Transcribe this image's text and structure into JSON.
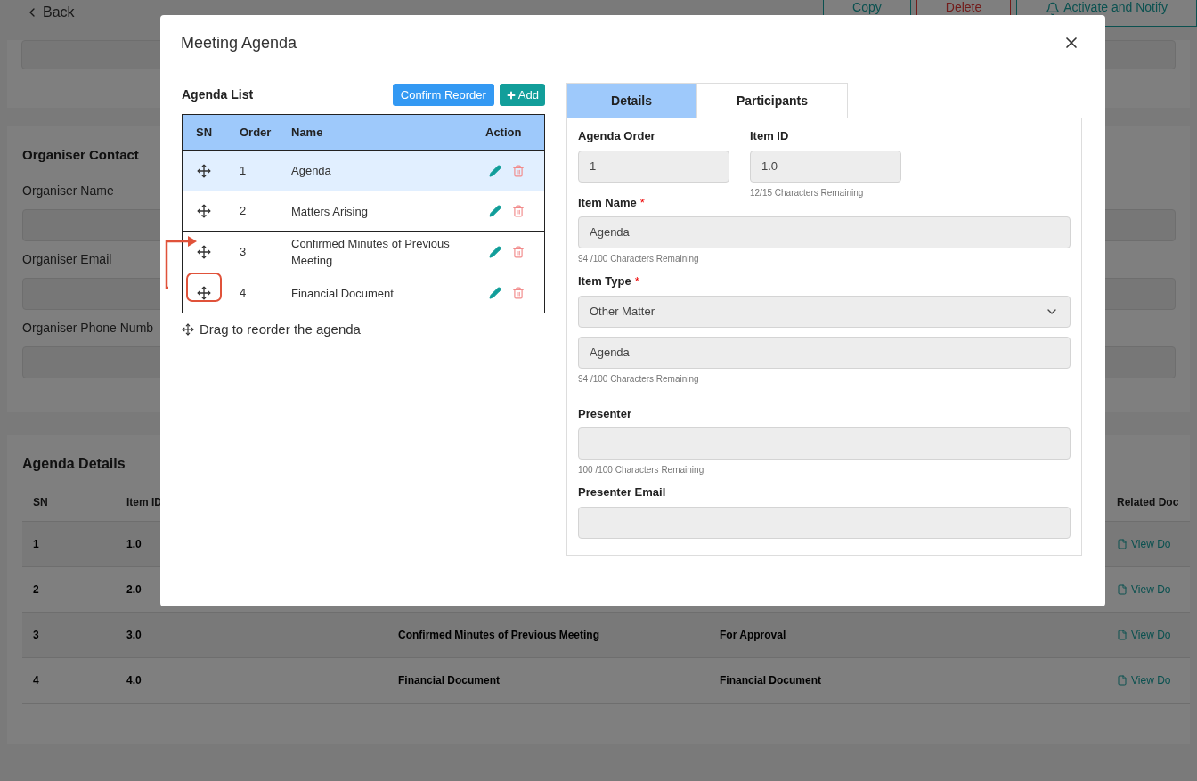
{
  "page": {
    "back": "Back",
    "header_buttons": [
      {
        "label": "Copy",
        "kind": "outline"
      },
      {
        "label": "Delete",
        "kind": "danger"
      },
      {
        "label": "Activate and Notify",
        "kind": "primary"
      }
    ],
    "organiser": {
      "title": "Organiser Contact",
      "fields": [
        "Organiser Name",
        "Organiser Email",
        "Organiser Phone Numb"
      ]
    },
    "agenda_details": {
      "title": "Agenda Details",
      "columns": {
        "sn": "SN",
        "item_id": "Item ID",
        "related": "Related Doc"
      },
      "rows": [
        {
          "sn": "1",
          "item_id": "1.0",
          "link": "View Do"
        },
        {
          "sn": "2",
          "item_id": "2.0",
          "link": "View Do"
        },
        {
          "sn": "3",
          "item_id": "3.0",
          "name": "Confirmed Minutes of Previous Meeting",
          "type": "For Approval",
          "link": "View Do"
        },
        {
          "sn": "4",
          "item_id": "4.0",
          "name": "Financial Document",
          "type": "Financial Document",
          "link": "View Do"
        }
      ]
    }
  },
  "modal": {
    "title": "Meeting Agenda",
    "agenda_list": {
      "title": "Agenda List",
      "confirm": "Confirm Reorder",
      "add": "Add",
      "columns": [
        "SN",
        "Order",
        "Name",
        "Action"
      ],
      "rows": [
        {
          "order": "1",
          "name": "Agenda",
          "selected": true
        },
        {
          "order": "2",
          "name": "Matters Arising",
          "selected": false
        },
        {
          "order": "3",
          "name": "Confirmed Minutes of Previous Meeting",
          "selected": false
        },
        {
          "order": "4",
          "name": "Financial Document",
          "selected": false
        }
      ],
      "hint": "Drag to reorder the agenda"
    },
    "tabs": [
      {
        "label": "Details",
        "selected": true
      },
      {
        "label": "Participants",
        "selected": false
      }
    ],
    "form": {
      "required_mark": "*",
      "agenda_order": {
        "label": "Agenda Order",
        "value": "1"
      },
      "item_id": {
        "label": "Item ID",
        "value": "1.0",
        "hint": "12/15 Characters Remaining"
      },
      "fields": [
        {
          "kind": "text",
          "label": "Item Name",
          "required": true,
          "value": "Agenda",
          "hint": "94 /100 Characters Remaining"
        },
        {
          "kind": "select",
          "label": "Item Type",
          "required": true,
          "value": "Other Matter"
        },
        {
          "kind": "text",
          "value": "Agenda",
          "hint": "94 /100 Characters Remaining"
        },
        {
          "kind": "text",
          "label": "Presenter",
          "required": false,
          "hint": "100 /100 Characters Remaining"
        },
        {
          "kind": "text",
          "label": "Presenter Email",
          "required": false
        }
      ]
    }
  }
}
